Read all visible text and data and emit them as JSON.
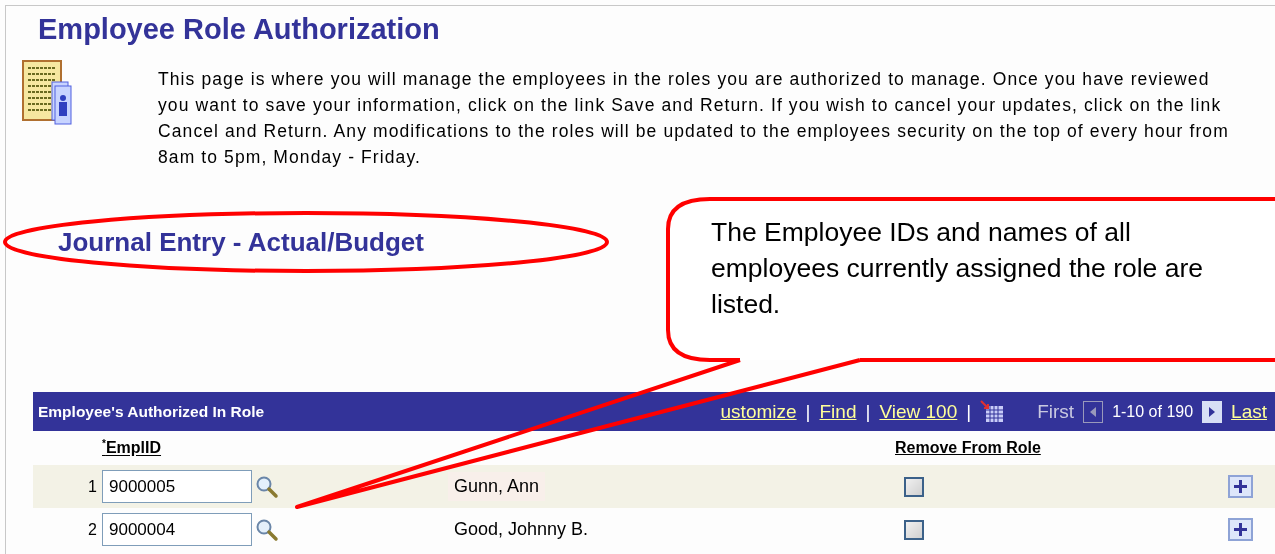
{
  "page_title": "Employee Role Authorization",
  "intro": "This page is where you will manage the employees in the roles you are authorized to manage. Once you have reviewed you want to save your information, click on the link Save and Return. If you wish to cancel your updates, click on the link Cancel and Return. Any modifications to the roles will be updated to the employees security on the top of every hour from 8am to 5pm, Monday - Friday.",
  "role_title": "Journal Entry - Actual/Budget",
  "callout": "The Employee IDs and names of all employees currently assigned the role are listed.",
  "grid": {
    "title": "Employee's Authorized In Role",
    "links": [
      "ustomize",
      "Find",
      "View 100"
    ],
    "separator": "|",
    "nav": {
      "first": "First",
      "range": "1-10 of 190",
      "last": "Last",
      "prev_disabled": true
    },
    "columns": [
      "$^{*}$EmplID",
      "Remove From Role"
    ],
    "rows": [
      {
        "number": "1",
        "emplid": "9000005",
        "name": "Gunn, Ann",
        "remove": false
      },
      {
        "number": "2",
        "emplid": "9000004",
        "name": "Good, Johnny B.",
        "remove": false
      }
    ]
  }
}
